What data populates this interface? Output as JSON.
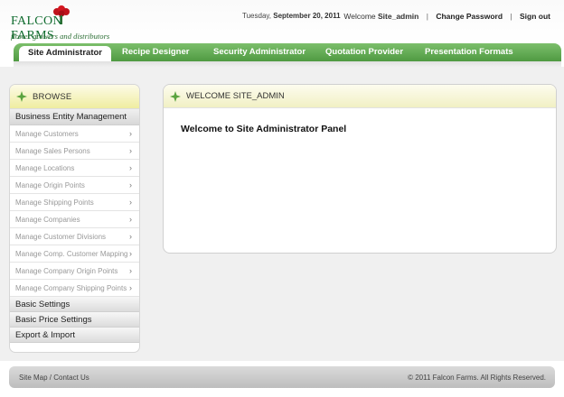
{
  "header": {
    "logo": {
      "title": "FALCON FARMS",
      "tagline": "flower growers and distributors"
    },
    "date_prefix": "Tuesday,",
    "date": "September 20, 2011",
    "welcome_label": "Welcome",
    "username": "Site_admin",
    "change_password": "Change Password",
    "sign_out": "Sign out",
    "separator": "|"
  },
  "nav": {
    "tabs": [
      {
        "label": "Site Administrator",
        "active": true
      },
      {
        "label": "Recipe Designer"
      },
      {
        "label": "Security Administrator"
      },
      {
        "label": "Quotation Provider"
      },
      {
        "label": "Presentation Formats"
      }
    ]
  },
  "sidebar": {
    "title": "BROWSE",
    "sections": [
      {
        "label": "Business Entity Management",
        "items": [
          {
            "label": "Manage Customers"
          },
          {
            "label": "Manage Sales Persons"
          },
          {
            "label": "Manage Locations"
          },
          {
            "label": "Manage Origin Points"
          },
          {
            "label": "Manage Shipping Points"
          },
          {
            "label": "Manage Companies"
          },
          {
            "label": "Manage Customer Divisions"
          },
          {
            "label": "Manage Comp. Customer Mapping"
          },
          {
            "label": "Manage Company Origin Points"
          },
          {
            "label": "Manage Company Shipping Points"
          }
        ]
      },
      {
        "label": "Basic Settings"
      },
      {
        "label": "Basic Price Settings"
      },
      {
        "label": "Export & Import"
      }
    ],
    "chevron": "›"
  },
  "panel": {
    "title": "WELCOME SITE_ADMIN",
    "message": "Welcome to Site Administrator Panel"
  },
  "footer": {
    "links": "Site Map / Contact Us",
    "copyright": "© 2011 Falcon Farms. All Rights Reserved."
  },
  "colors": {
    "brand_green": "#4f9a42",
    "accent_yellow": "#efeda0",
    "logo_green": "#0f6b2e",
    "flower_red": "#c0121c"
  },
  "icons": [
    "leaf-icon",
    "chevron-right-icon",
    "flower-logo-icon"
  ]
}
